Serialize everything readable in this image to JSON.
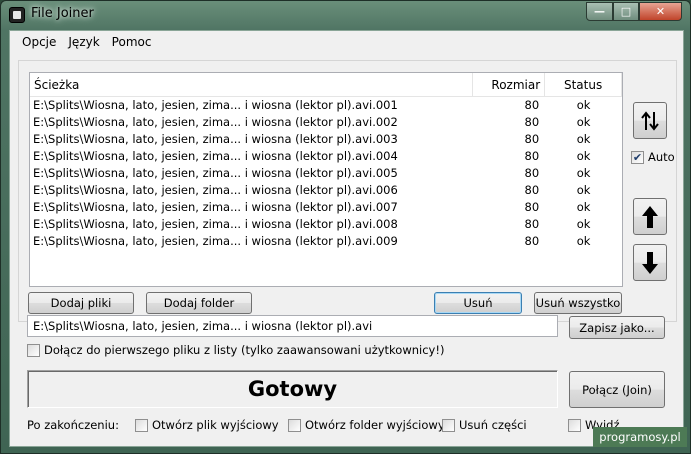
{
  "window": {
    "title": "File Joiner"
  },
  "menu": [
    "Opcje",
    "Język",
    "Pomoc"
  ],
  "list": {
    "headers": {
      "path": "Ścieżka",
      "size": "Rozmiar",
      "status": "Status"
    },
    "rows": [
      {
        "path": "E:\\Splits\\Wiosna, lato, jesien, zima... i wiosna (lektor pl).avi.001",
        "size": "80",
        "status": "ok"
      },
      {
        "path": "E:\\Splits\\Wiosna, lato, jesien, zima... i wiosna (lektor pl).avi.002",
        "size": "80",
        "status": "ok"
      },
      {
        "path": "E:\\Splits\\Wiosna, lato, jesien, zima... i wiosna (lektor pl).avi.003",
        "size": "80",
        "status": "ok"
      },
      {
        "path": "E:\\Splits\\Wiosna, lato, jesien, zima... i wiosna (lektor pl).avi.004",
        "size": "80",
        "status": "ok"
      },
      {
        "path": "E:\\Splits\\Wiosna, lato, jesien, zima... i wiosna (lektor pl).avi.005",
        "size": "80",
        "status": "ok"
      },
      {
        "path": "E:\\Splits\\Wiosna, lato, jesien, zima... i wiosna (lektor pl).avi.006",
        "size": "80",
        "status": "ok"
      },
      {
        "path": "E:\\Splits\\Wiosna, lato, jesien, zima... i wiosna (lektor pl).avi.007",
        "size": "80",
        "status": "ok"
      },
      {
        "path": "E:\\Splits\\Wiosna, lato, jesien, zima... i wiosna (lektor pl).avi.008",
        "size": "80",
        "status": "ok"
      },
      {
        "path": "E:\\Splits\\Wiosna, lato, jesien, zima... i wiosna (lektor pl).avi.009",
        "size": "80",
        "status": "ok"
      }
    ]
  },
  "side": {
    "auto_label": "Auto",
    "auto_checked": true
  },
  "buttons": {
    "add_files": "Dodaj pliki",
    "add_folder": "Dodaj folder",
    "remove": "Usuń",
    "remove_all": "Usuń wszystko",
    "save_as": "Zapisz jako...",
    "join": "Połącz (Join)"
  },
  "output": {
    "path": "E:\\Splits\\Wiosna, lato, jesien, zima... i wiosna (lektor pl).avi"
  },
  "append_option": {
    "label": "Dołącz do pierwszego pliku z listy (tylko zaawansowani użytkownicy!)",
    "checked": false
  },
  "status": {
    "text": "Gotowy"
  },
  "after": {
    "label": "Po zakończeniu:",
    "options": [
      {
        "label": "Otwórz plik wyjściowy",
        "checked": false
      },
      {
        "label": "Otwórz folder wyjściowy",
        "checked": false
      },
      {
        "label": "Usuń części",
        "checked": false
      },
      {
        "label": "Wyjdź",
        "checked": false
      }
    ]
  },
  "watermark": "programosy.pl",
  "icons": {
    "sort": "sort-up-down-icon",
    "up": "arrow-up-icon",
    "down": "arrow-down-icon"
  }
}
